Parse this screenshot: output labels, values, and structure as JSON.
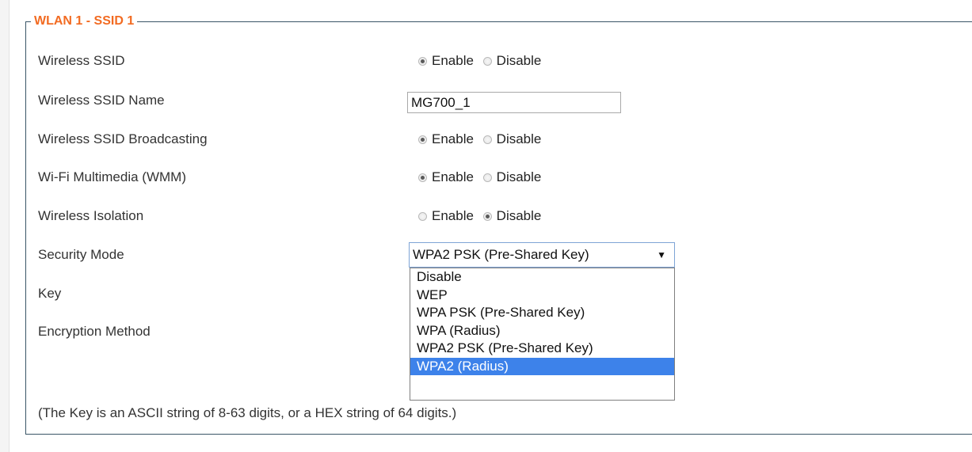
{
  "legend": "WLAN 1 - SSID 1",
  "rows": {
    "wireless_ssid": {
      "label": "Wireless SSID",
      "enable": "Enable",
      "disable": "Disable",
      "selected": "enable"
    },
    "ssid_name": {
      "label": "Wireless SSID Name",
      "value": "MG700_1"
    },
    "ssid_broadcasting": {
      "label": "Wireless SSID Broadcasting",
      "enable": "Enable",
      "disable": "Disable",
      "selected": "enable"
    },
    "wmm": {
      "label": "Wi-Fi Multimedia (WMM)",
      "enable": "Enable",
      "disable": "Disable",
      "selected": "enable"
    },
    "isolation": {
      "label": "Wireless Isolation",
      "enable": "Enable",
      "disable": "Disable",
      "selected": "disable"
    },
    "security_mode": {
      "label": "Security Mode",
      "value": "WPA2 PSK (Pre-Shared Key)",
      "options": [
        "Disable",
        "WEP",
        "WPA PSK (Pre-Shared Key)",
        "WPA (Radius)",
        "WPA2 PSK (Pre-Shared Key)",
        "WPA2 (Radius)"
      ],
      "highlighted": "WPA2 (Radius)"
    },
    "key": {
      "label": "Key"
    },
    "encryption": {
      "label": "Encryption Method"
    }
  },
  "note": "(The Key is an ASCII string of 8-63 digits, or a HEX string of 64 digits.)",
  "colors": {
    "legend": "#f26b22",
    "border": "#3a5566",
    "highlight": "#3d82ea"
  }
}
